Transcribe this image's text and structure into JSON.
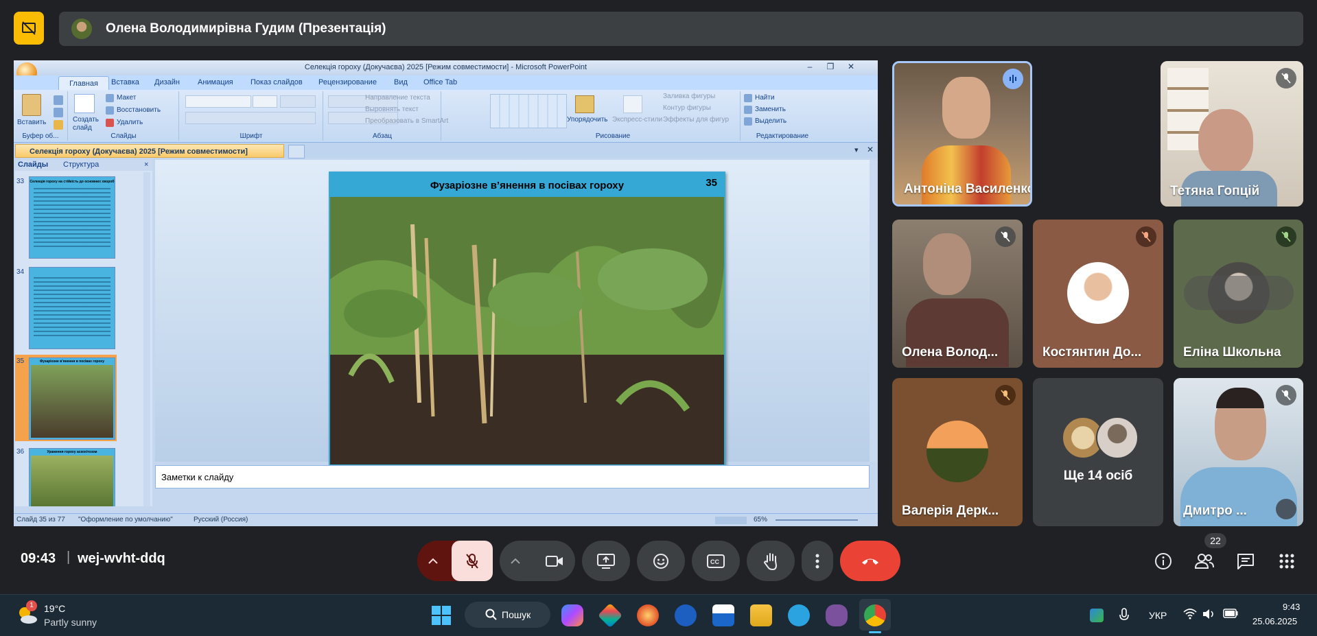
{
  "presenter_banner": {
    "title": "Олена Володимирівна Гудим (Презентація)"
  },
  "powerpoint": {
    "window_title": "Селекція гороху (Докучаєва) 2025 [Режим совместимости] - Microsoft PowerPoint",
    "ribbon_tabs": [
      "Главная",
      "Вставка",
      "Дизайн",
      "Анимация",
      "Показ слайдов",
      "Рецензирование",
      "Вид",
      "Office Tab"
    ],
    "groups": {
      "clipboard": {
        "title": "Буфер об...",
        "paste": "Вставить"
      },
      "slides": {
        "title": "Слайды",
        "new_slide": "Создать слайд",
        "layout": "Макет",
        "reset": "Восстановить",
        "delete": "Удалить"
      },
      "font": {
        "title": "Шрифт"
      },
      "paragraph": {
        "title": "Абзац",
        "text_direction": "Направление текста",
        "align_text": "Выровнять текст",
        "smartart": "Преобразовать в SmartArt"
      },
      "drawing": {
        "title": "Рисование",
        "arrange": "Упорядочить",
        "quick_styles": "Экспресс-стили",
        "fill": "Заливка фигуры",
        "outline": "Контур фигуры",
        "effects": "Эффекты для фигур"
      },
      "editing": {
        "title": "Редактирование",
        "find": "Найти",
        "replace": "Заменить",
        "select": "Выделить"
      }
    },
    "doc_tab": "Селекція гороху (Докучаєва) 2025 [Режим совместимости]",
    "panel_tabs": {
      "slides": "Слайды",
      "outline": "Структура"
    },
    "thumbnails": [
      {
        "num": "33",
        "title": "Селекція гороху на стійкість до основних хвороб"
      },
      {
        "num": "34",
        "title": ""
      },
      {
        "num": "35",
        "title": "Фузаріозне в’янення в посівах гороху"
      },
      {
        "num": "36",
        "title": "Ураження гороху аскохітозом"
      }
    ],
    "slide": {
      "title": "Фузаріозне в’янення в посівах гороху",
      "number": "35"
    },
    "notes_placeholder": "Заметки к слайду",
    "status": {
      "slide_info": "Слайд 35 из 77",
      "theme": "\"Оформление по умолчанию\"",
      "language": "Русский (Россия)",
      "zoom": "65%"
    }
  },
  "participants": [
    {
      "name": "Антоніна Василенко",
      "speaking": true
    },
    {
      "name": "Тетяна Гопцій",
      "muted": true
    },
    {
      "name": "Олена Волод...",
      "muted": true
    },
    {
      "name": "Костянтин До...",
      "muted": true
    },
    {
      "name": "Еліна Школьна",
      "muted": true
    },
    {
      "name": "Валерія Дерк...",
      "muted": true
    },
    {
      "name": "Ще 14 осіб"
    },
    {
      "name": "Дмитро ...",
      "muted": true
    }
  ],
  "meeting": {
    "time": "09:43",
    "separator": "|",
    "code": "wej-wvht-ddq",
    "participant_count": "22"
  },
  "taskbar": {
    "weather_temp": "19°C",
    "weather_desc": "Partly sunny",
    "weather_badge": "1",
    "search": "Пошук",
    "lang": "УКР",
    "clock_time": "9:43",
    "clock_date": "25.06.2025"
  },
  "colors": {
    "accent_yellow": "#fbbc04",
    "end_call_red": "#ea4335",
    "mic_muted_bg": "#f9dedc",
    "mic_muted_left": "#601410"
  }
}
